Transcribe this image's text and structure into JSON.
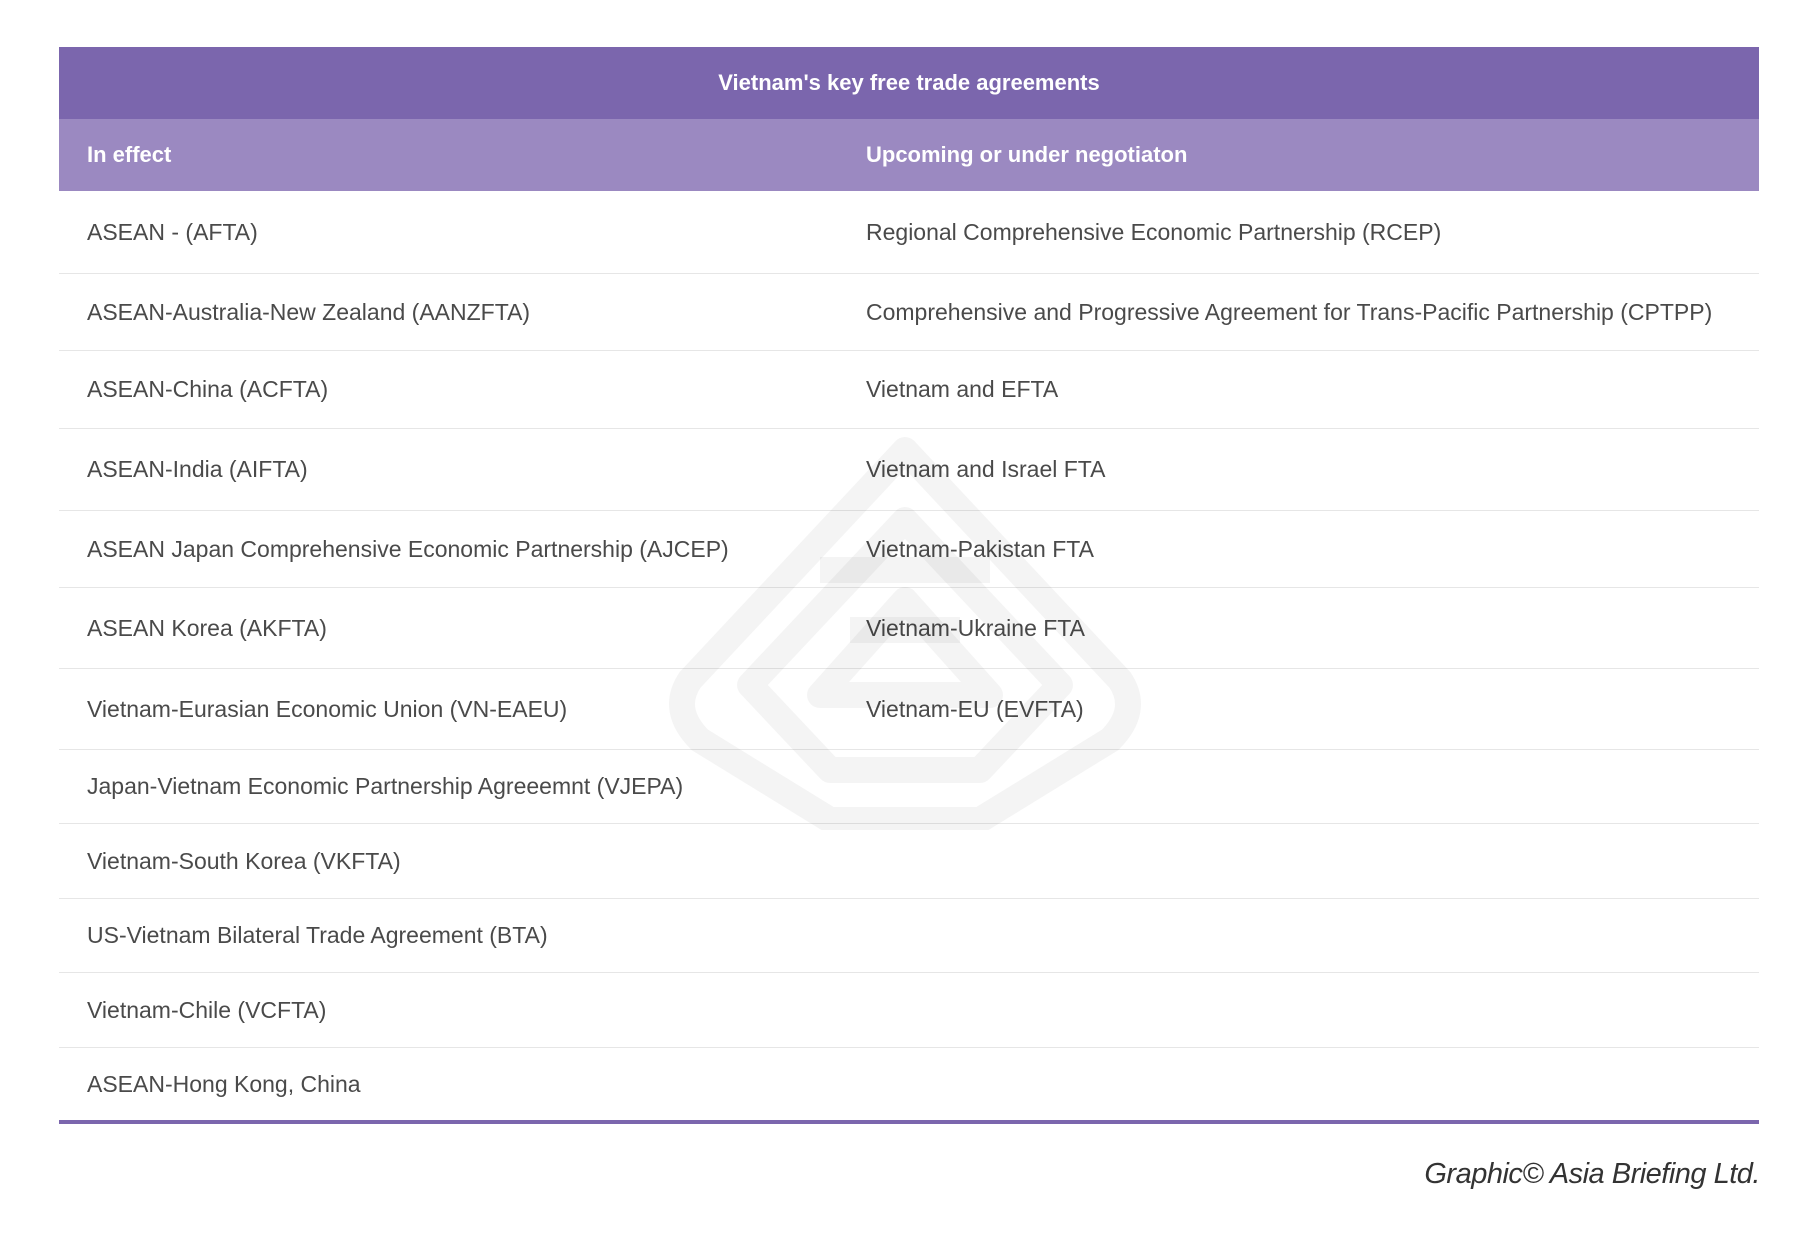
{
  "table": {
    "title": "Vietnam's key free trade agreements",
    "headers": {
      "left": "In effect",
      "right": "Upcoming or under negotiaton"
    },
    "rows": [
      {
        "left": "ASEAN - (AFTA)",
        "right": "Regional Comprehensive Economic Partnership (RCEP)"
      },
      {
        "left": "ASEAN-Australia-New Zealand (AANZFTA)",
        "right": "Comprehensive and Progressive Agreement for Trans-Pacific Partnership (CPTPP)"
      },
      {
        "left": "ASEAN-China (ACFTA)",
        "right": "Vietnam and EFTA"
      },
      {
        "left": "ASEAN-India (AIFTA)",
        "right": "Vietnam and Israel FTA"
      },
      {
        "left": "ASEAN Japan Comprehensive Economic Partnership (AJCEP)",
        "right": "Vietnam-Pakistan FTA"
      },
      {
        "left": "ASEAN Korea (AKFTA)",
        "right": "Vietnam-Ukraine FTA"
      },
      {
        "left": "Vietnam-Eurasian Economic Union (VN-EAEU)",
        "right": "Vietnam-EU (EVFTA)"
      },
      {
        "left": "Japan-Vietnam Economic Partnership Agreeemnt (VJEPA)",
        "right": ""
      },
      {
        "left": "Vietnam-South Korea (VKFTA)",
        "right": ""
      },
      {
        "left": "US-Vietnam Bilateral Trade Agreement (BTA)",
        "right": ""
      },
      {
        "left": "Vietnam-Chile (VCFTA)",
        "right": ""
      },
      {
        "left": "ASEAN-Hong Kong, China",
        "right": ""
      }
    ]
  },
  "credit": "Graphic© Asia Briefing Ltd.",
  "colors": {
    "title_bg": "#7b66ad",
    "header_bg": "#9b89c1",
    "text": "#4a4a4a"
  }
}
